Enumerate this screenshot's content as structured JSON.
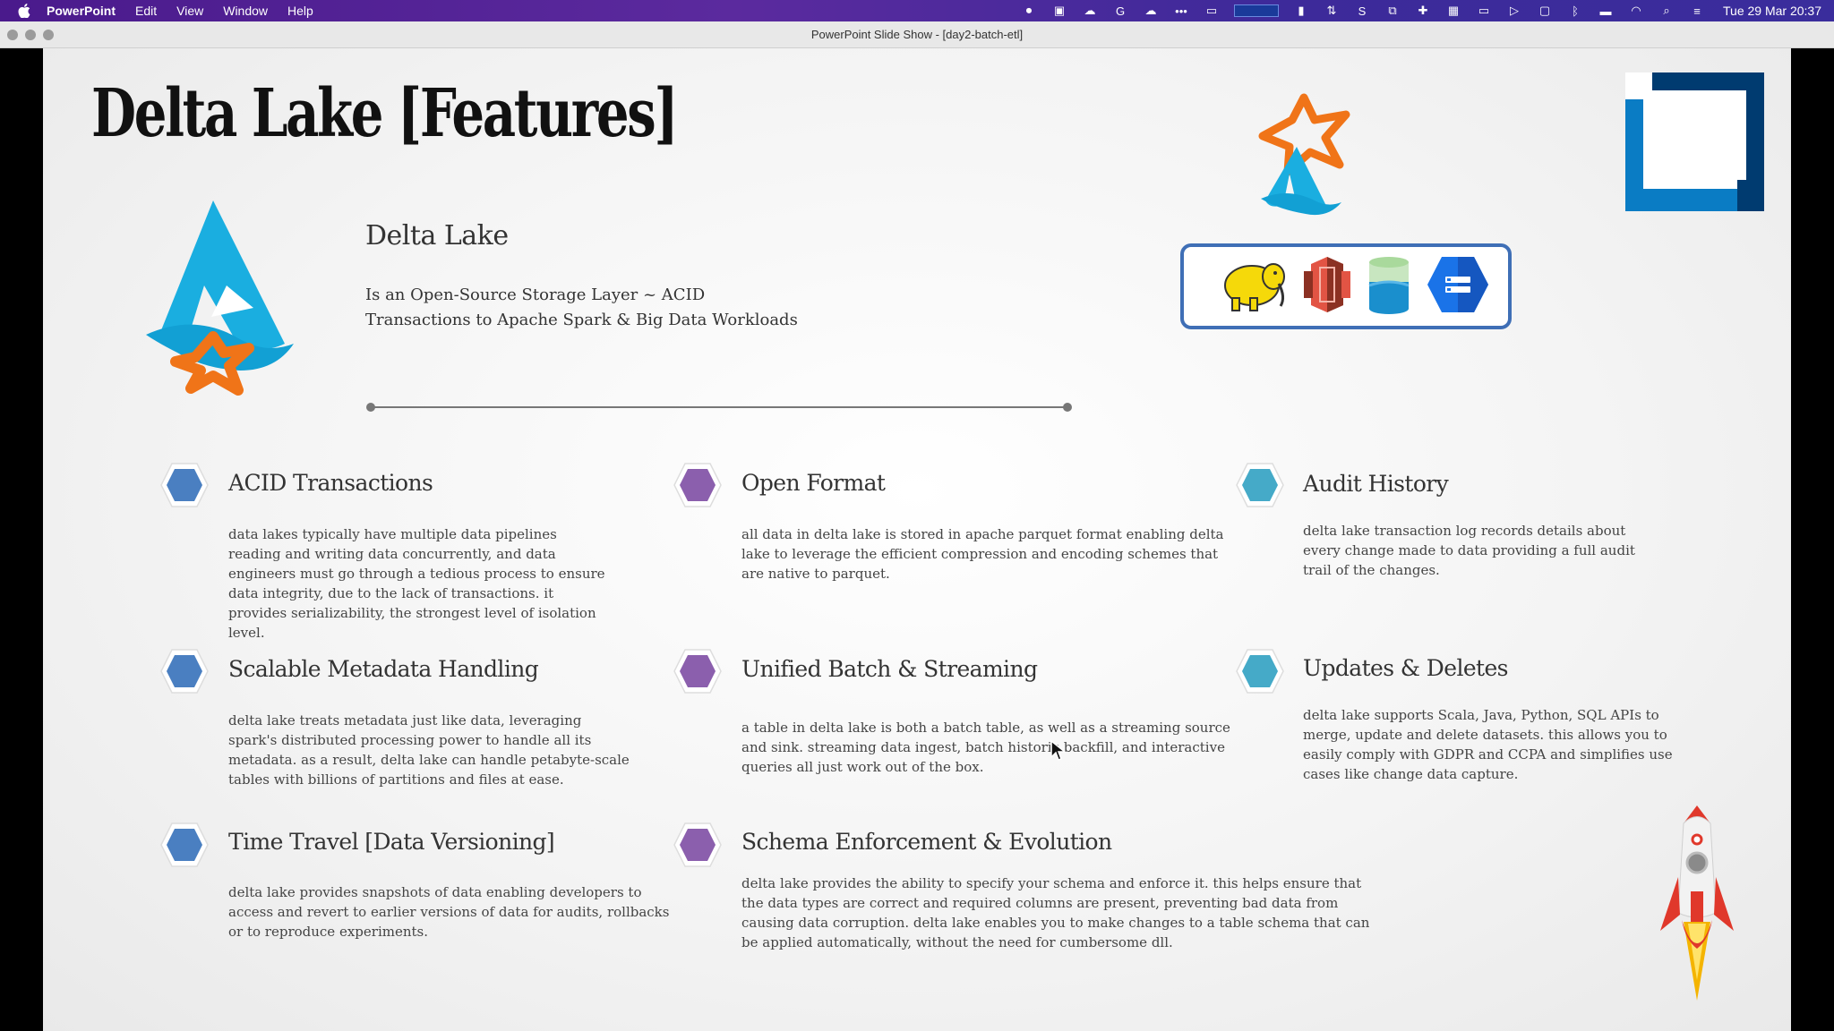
{
  "menubar": {
    "app_name": "PowerPoint",
    "menus": [
      "Edit",
      "View",
      "Window",
      "Help"
    ],
    "clock": "Tue 29 Mar  20:37",
    "status_icons": [
      "screen-record-icon",
      "window-icon",
      "cloud-sync-icon",
      "grammarly-icon",
      "onedrive-icon",
      "dots-icon",
      "display-icon",
      "cpu-graph-icon",
      "memory-icon",
      "network-icon",
      "skype-icon",
      "screen-mirror-icon",
      "plugin-icon",
      "layout-icon",
      "cast-icon",
      "play-icon",
      "stage-icon",
      "bluetooth-icon",
      "battery-icon",
      "wifi-icon",
      "search-icon",
      "control-center-icon"
    ]
  },
  "window": {
    "title": "PowerPoint Slide Show - [day2-batch-etl]"
  },
  "slide": {
    "title": "Delta Lake [Features]",
    "hero": {
      "heading": "Delta Lake",
      "description_line1": "Is an Open-Source Storage Layer ~ ACID",
      "description_line2": "Transactions to Apache Spark & Big Data Workloads"
    },
    "integrations": [
      "hadoop-icon",
      "aws-s3-icon",
      "azure-data-lake-icon",
      "google-cloud-storage-icon"
    ],
    "features": [
      {
        "title": "ACID Transactions",
        "color": "#4a7fc1",
        "desc": "data lakes typically have multiple data pipelines reading and writing data concurrently, and data engineers must go through a tedious process to ensure data integrity, due to the lack of transactions. it provides serializability, the strongest level of isolation level."
      },
      {
        "title": "Open Format",
        "color": "#8b5fad",
        "desc": "all data in delta lake is stored in apache parquet format enabling delta lake to leverage the efficient compression and encoding schemes that are native to parquet."
      },
      {
        "title": "Audit History",
        "color": "#45aac8",
        "desc": "delta lake transaction log records details about every change made to data providing a full audit trail of the changes."
      },
      {
        "title": "Scalable Metadata Handling",
        "color": "#4a7fc1",
        "desc": "delta lake treats metadata just like data, leveraging spark's distributed processing power to handle all its metadata. as a result, delta lake can handle petabyte-scale tables with billions of partitions and files at ease."
      },
      {
        "title": "Unified Batch & Streaming",
        "color": "#8b5fad",
        "desc": "a table in delta lake is both a batch table, as well as a streaming source and sink. streaming data ingest, batch historic backfill, and interactive queries all just work out of the box."
      },
      {
        "title": "Updates & Deletes",
        "color": "#45aac8",
        "desc": "delta lake supports Scala, Java, Python, SQL APIs to merge, update and delete datasets. this allows you to easily comply with GDPR and CCPA and simplifies use cases like change data capture."
      },
      {
        "title": "Time Travel [Data Versioning]",
        "color": "#4a7fc1",
        "desc": "delta lake provides snapshots of data enabling developers to access and revert to earlier versions of data for audits, rollbacks or to reproduce experiments."
      },
      {
        "title": "Schema Enforcement & Evolution",
        "color": "#8b5fad",
        "desc": "delta lake provides the ability to specify your schema and enforce it. this helps ensure that the data types are correct and required columns are present, preventing bad data from causing data corruption. delta lake enables you to make changes to a table schema that can be applied automatically, without the need for cumbersome dll."
      }
    ]
  }
}
